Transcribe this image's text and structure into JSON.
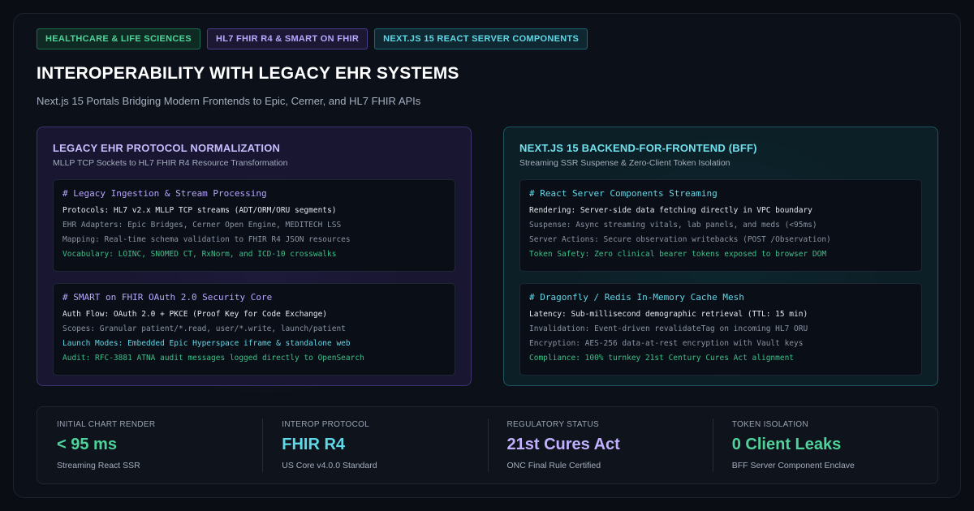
{
  "badges": [
    "HEALTHCARE & LIFE SCIENCES",
    "HL7 FHIR R4 & SMART ON FHIR",
    "NEXT.JS 15 REACT SERVER COMPONENTS"
  ],
  "header": {
    "title": "INTEROPERABILITY WITH LEGACY EHR SYSTEMS",
    "subtitle": "Next.js 15 Portals Bridging Modern Frontends to Epic, Cerner, and HL7 FHIR APIs"
  },
  "left_panel": {
    "title": "LEGACY EHR PROTOCOL NORMALIZATION",
    "subtitle": "MLLP TCP Sockets to HL7 FHIR R4 Resource Transformation",
    "blocks": [
      {
        "heading": "# Legacy Ingestion & Stream Processing",
        "lines": [
          "Protocols: HL7 v2.x MLLP TCP streams (ADT/ORM/ORU segments)",
          "EHR Adapters: Epic Bridges, Cerner Open Engine, MEDITECH LSS",
          "Mapping: Real-time schema validation to FHIR R4 JSON resources",
          "Vocabulary: LOINC, SNOMED CT, RxNorm, and ICD-10 crosswalks"
        ]
      },
      {
        "heading": "# SMART on FHIR OAuth 2.0 Security Core",
        "lines": [
          "Auth Flow: OAuth 2.0 + PKCE (Proof Key for Code Exchange)",
          "Scopes: Granular patient/*.read, user/*.write, launch/patient",
          "Launch Modes: Embedded Epic Hyperspace iframe & standalone web",
          "Audit: RFC-3881 ATNA audit messages logged directly to OpenSearch"
        ]
      }
    ]
  },
  "right_panel": {
    "title": "NEXT.JS 15 BACKEND-FOR-FRONTEND (BFF)",
    "subtitle": "Streaming SSR Suspense & Zero-Client Token Isolation",
    "blocks": [
      {
        "heading": "# React Server Components Streaming",
        "lines": [
          "Rendering: Server-side data fetching directly in VPC boundary",
          "Suspense: Async streaming vitals, lab panels, and meds (<95ms)",
          "Server Actions: Secure observation writebacks (POST /Observation)",
          "Token Safety: Zero clinical bearer tokens exposed to browser DOM"
        ]
      },
      {
        "heading": "# Dragonfly / Redis In-Memory Cache Mesh",
        "lines": [
          "Latency: Sub-millisecond demographic retrieval (TTL: 15 min)",
          "Invalidation: Event-driven revalidateTag on incoming HL7 ORU",
          "Encryption: AES-256 data-at-rest encryption with Vault keys",
          "Compliance: 100% turnkey 21st Century Cures Act alignment"
        ]
      }
    ]
  },
  "stats": [
    {
      "label": "INITIAL CHART RENDER",
      "value": "< 95 ms",
      "caption": "Streaming React SSR",
      "color": "#4ed39b"
    },
    {
      "label": "INTEROP PROTOCOL",
      "value": "FHIR R4",
      "caption": "US Core v4.0.0 Standard",
      "color": "#5fd8e8"
    },
    {
      "label": "REGULATORY STATUS",
      "value": "21st Cures Act",
      "caption": "ONC Final Rule Certified",
      "color": "#c0b0ff"
    },
    {
      "label": "TOKEN ISOLATION",
      "value": "0 Client Leaks",
      "caption": "BFF Server Component Enclave",
      "color": "#4ed39b"
    }
  ]
}
